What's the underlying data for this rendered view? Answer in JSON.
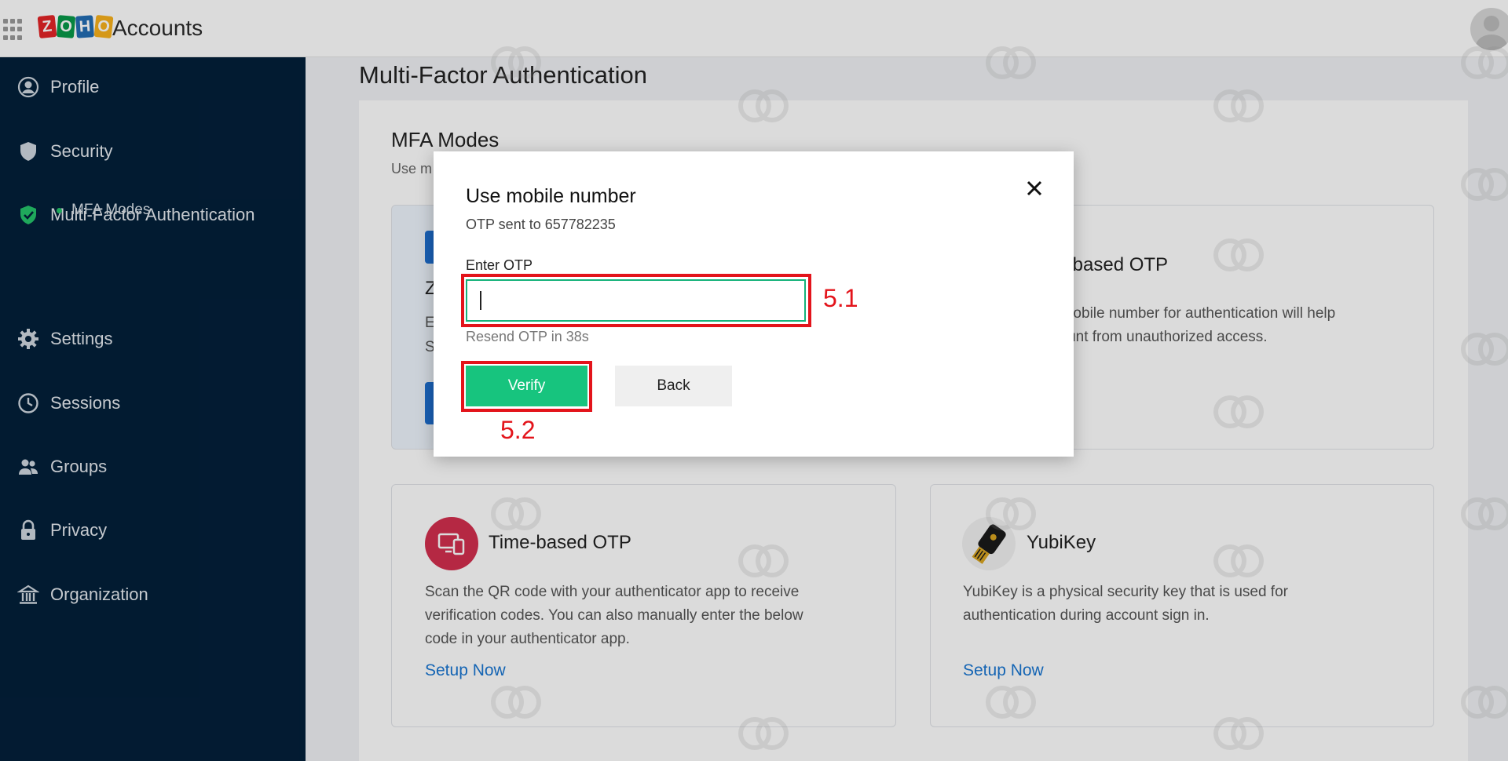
{
  "header": {
    "app_title": "Accounts",
    "logo_letters": [
      "Z",
      "O",
      "H",
      "O"
    ],
    "logo_colors": [
      "#e42527",
      "#089949",
      "#226db4",
      "#f9b21d"
    ]
  },
  "sidebar": {
    "items": [
      {
        "label": "Profile",
        "icon": "profile-icon"
      },
      {
        "label": "Security",
        "icon": "shield-icon"
      },
      {
        "label": "Multi-Factor Authentication",
        "icon": "shield-check-icon"
      },
      {
        "label": "Settings",
        "icon": "gear-icon"
      },
      {
        "label": "Sessions",
        "icon": "clock-icon"
      },
      {
        "label": "Groups",
        "icon": "group-icon"
      },
      {
        "label": "Privacy",
        "icon": "lock-icon"
      },
      {
        "label": "Organization",
        "icon": "building-icon"
      }
    ],
    "sub_item": "MFA Modes"
  },
  "main": {
    "title": "Multi-Factor Authentication",
    "section_title": "MFA Modes",
    "section_sub_partial": "Use m",
    "card1_partial": [
      "Z",
      "E",
      "S"
    ],
    "card2_title_partial": "le-based OTP",
    "card2_desc_lines": [
      "r mobile number for authentication will help",
      "count from unauthorized access."
    ],
    "card3": {
      "title": "Time-based OTP",
      "desc_lines": [
        "Scan the QR code with your authenticator app to receive",
        "verification codes. You can also manually enter the below",
        "code in your authenticator app."
      ],
      "link": "Setup Now"
    },
    "card4": {
      "title": "YubiKey",
      "desc_lines": [
        "YubiKey is a physical security key that is used for",
        "authentication during account sign in."
      ],
      "link": "Setup Now"
    }
  },
  "modal": {
    "title": "Use mobile number",
    "subtitle": "OTP sent to 657782235",
    "otp_label": "Enter OTP",
    "otp_value": "",
    "resend_text": "Resend OTP in 38s",
    "verify_label": "Verify",
    "back_label": "Back"
  },
  "annotations": {
    "label_input": "5.1",
    "label_verify": "5.2"
  },
  "colors": {
    "sidebar_bg": "#03203a",
    "accent_green": "#17c47e",
    "annotation_red": "#e3141b",
    "link_blue": "#1976d2"
  }
}
